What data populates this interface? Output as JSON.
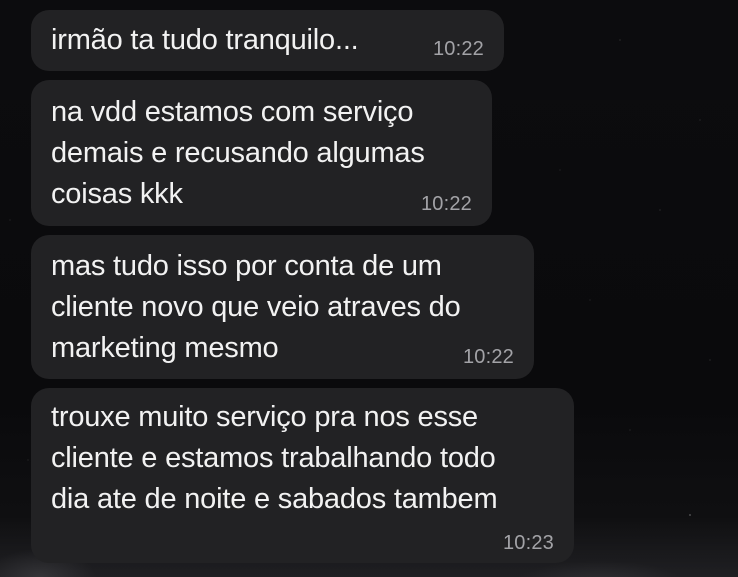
{
  "conversation": {
    "messages": [
      {
        "text": "irmão ta tudo tranquilo...",
        "time": "10:22"
      },
      {
        "text": "na vdd estamos com serviço\ndemais e recusando algumas\ncoisas kkk",
        "time": "10:22"
      },
      {
        "text": "mas tudo isso por conta de um\ncliente novo que veio atraves do\nmarketing mesmo",
        "time": "10:22"
      },
      {
        "text": "trouxe muito serviço pra nos esse\ncliente e estamos trabalhando todo\ndia ate de noite e sabados tambem",
        "time": "10:23"
      }
    ]
  }
}
